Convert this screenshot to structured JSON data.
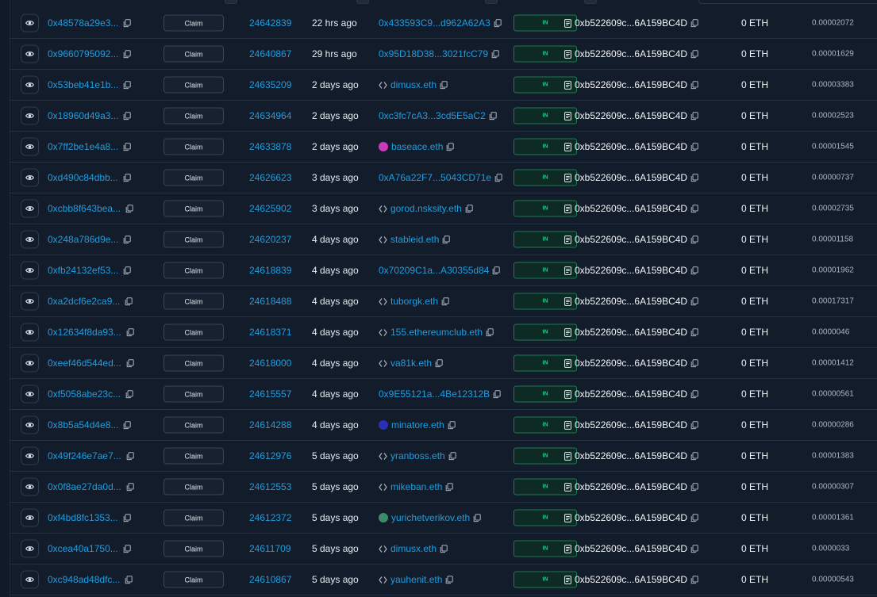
{
  "table": {
    "claim_label": "Claim",
    "direction_label": "IN",
    "rows": [
      {
        "hash": "0x48578a29e3...",
        "block": "24642839",
        "age": "22 hrs ago",
        "from": "0x433593C9...d962A62A3",
        "from_type": "address",
        "to": "0xb522609c...6A159BC4D",
        "value": "0 ETH",
        "fee": "0.00002072"
      },
      {
        "hash": "0x9660795092...",
        "block": "24640867",
        "age": "29 hrs ago",
        "from": "0x95D18D38...3021fcC79",
        "from_type": "address",
        "to": "0xb522609c...6A159BC4D",
        "value": "0 ETH",
        "fee": "0.00001629"
      },
      {
        "hash": "0x53beb41e1b...",
        "block": "24635209",
        "age": "2 days ago",
        "from": "dimusx.eth",
        "from_type": "ens",
        "to": "0xb522609c...6A159BC4D",
        "value": "0 ETH",
        "fee": "0.00003383"
      },
      {
        "hash": "0x18960d49a3...",
        "block": "24634964",
        "age": "2 days ago",
        "from": "0xc3fc7cA3...3cd5E5aC2",
        "from_type": "address",
        "to": "0xb522609c...6A159BC4D",
        "value": "0 ETH",
        "fee": "0.00002523"
      },
      {
        "hash": "0x7ff2be1e4a8...",
        "block": "24633878",
        "age": "2 days ago",
        "from": "baseace.eth",
        "from_type": "avatar",
        "avatar_color": "#c83ab8",
        "to": "0xb522609c...6A159BC4D",
        "value": "0 ETH",
        "fee": "0.00001545"
      },
      {
        "hash": "0xd490c84dbb...",
        "block": "24626623",
        "age": "3 days ago",
        "from": "0xA76a22F7...5043CD71e",
        "from_type": "address",
        "to": "0xb522609c...6A159BC4D",
        "value": "0 ETH",
        "fee": "0.00000737"
      },
      {
        "hash": "0xcbb8f643bea...",
        "block": "24625902",
        "age": "3 days ago",
        "from": "gorod.nsksity.eth",
        "from_type": "ens",
        "to": "0xb522609c...6A159BC4D",
        "value": "0 ETH",
        "fee": "0.00002735"
      },
      {
        "hash": "0x248a786d9e...",
        "block": "24620237",
        "age": "4 days ago",
        "from": "stableid.eth",
        "from_type": "ens",
        "to": "0xb522609c...6A159BC4D",
        "value": "0 ETH",
        "fee": "0.00001158"
      },
      {
        "hash": "0xfb24132ef53...",
        "block": "24618839",
        "age": "4 days ago",
        "from": "0x70209C1a...A30355d84",
        "from_type": "address",
        "to": "0xb522609c...6A159BC4D",
        "value": "0 ETH",
        "fee": "0.00001962"
      },
      {
        "hash": "0xa2dcf6e2ca9...",
        "block": "24618488",
        "age": "4 days ago",
        "from": "tuborgk.eth",
        "from_type": "ens",
        "to": "0xb522609c...6A159BC4D",
        "value": "0 ETH",
        "fee": "0.00017317"
      },
      {
        "hash": "0x12634f8da93...",
        "block": "24618371",
        "age": "4 days ago",
        "from": "155.ethereumclub.eth",
        "from_type": "ens",
        "to": "0xb522609c...6A159BC4D",
        "value": "0 ETH",
        "fee": "0.0000046"
      },
      {
        "hash": "0xeef46d544ed...",
        "block": "24618000",
        "age": "4 days ago",
        "from": "va81k.eth",
        "from_type": "ens",
        "to": "0xb522609c...6A159BC4D",
        "value": "0 ETH",
        "fee": "0.00001412"
      },
      {
        "hash": "0xf5058abe23c...",
        "block": "24615557",
        "age": "4 days ago",
        "from": "0x9E55121a...4Be12312B",
        "from_type": "address",
        "to": "0xb522609c...6A159BC4D",
        "value": "0 ETH",
        "fee": "0.00000561"
      },
      {
        "hash": "0x8b5a54d4e8...",
        "block": "24614288",
        "age": "4 days ago",
        "from": "minatore.eth",
        "from_type": "avatar",
        "avatar_color": "#2a2fb8",
        "to": "0xb522609c...6A159BC4D",
        "value": "0 ETH",
        "fee": "0.00000286"
      },
      {
        "hash": "0x49f246e7ae7...",
        "block": "24612976",
        "age": "5 days ago",
        "from": "yranboss.eth",
        "from_type": "ens",
        "to": "0xb522609c...6A159BC4D",
        "value": "0 ETH",
        "fee": "0.00001383"
      },
      {
        "hash": "0x0f8ae27da0d...",
        "block": "24612553",
        "age": "5 days ago",
        "from": "mikeban.eth",
        "from_type": "ens",
        "to": "0xb522609c...6A159BC4D",
        "value": "0 ETH",
        "fee": "0.00000307"
      },
      {
        "hash": "0xf4bd8fc1353...",
        "block": "24612372",
        "age": "5 days ago",
        "from": "yurichetverikov.eth",
        "from_type": "avatar",
        "avatar_color": "#3a8c6a",
        "to": "0xb522609c...6A159BC4D",
        "value": "0 ETH",
        "fee": "0.00001361"
      },
      {
        "hash": "0xcea40a1750...",
        "block": "24611709",
        "age": "5 days ago",
        "from": "dimusx.eth",
        "from_type": "ens",
        "to": "0xb522609c...6A159BC4D",
        "value": "0 ETH",
        "fee": "0.0000033"
      },
      {
        "hash": "0xc948ad48dfc...",
        "block": "24610867",
        "age": "5 days ago",
        "from": "yauhenit.eth",
        "from_type": "ens",
        "to": "0xb522609c...6A159BC4D",
        "value": "0 ETH",
        "fee": "0.00000543"
      }
    ]
  },
  "colors": {
    "link": "#1f9ee0",
    "in_badge": "#20c98a",
    "background": "#131c2b"
  }
}
